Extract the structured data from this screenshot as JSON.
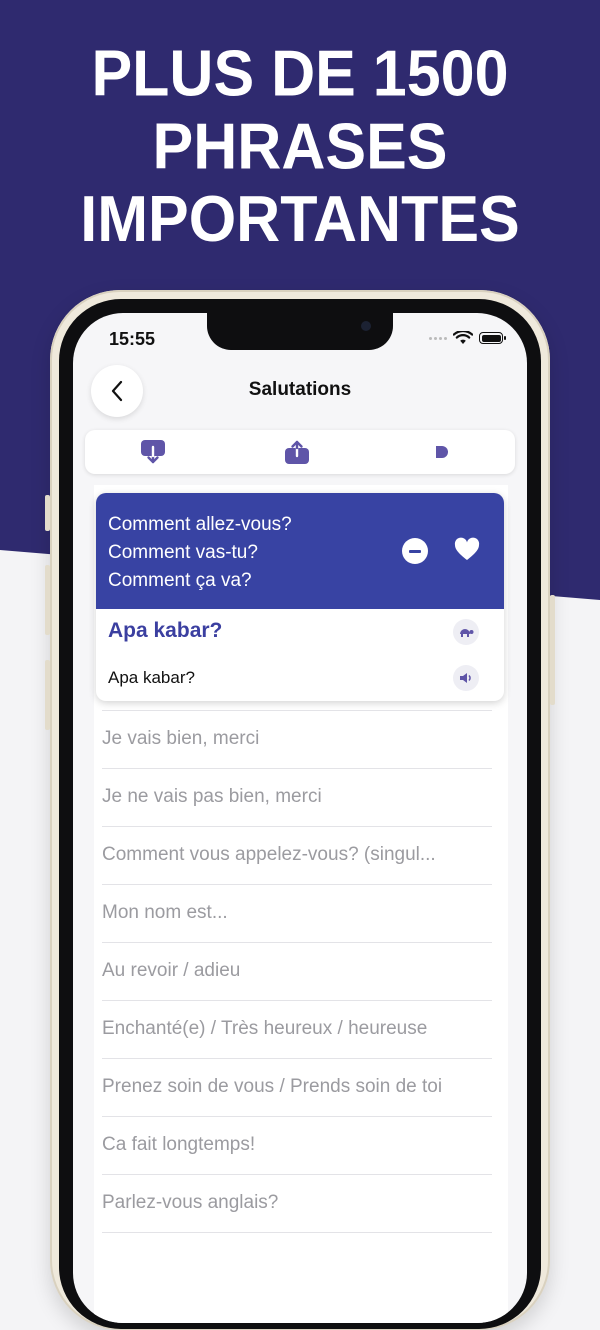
{
  "banner": {
    "lines": [
      "PLUS DE 1500",
      "PHRASES",
      "IMPORTANTES"
    ]
  },
  "status_bar": {
    "time": "15:55"
  },
  "header": {
    "title": "Salutations",
    "back_icon": "chevron-left-icon"
  },
  "toolbar": {
    "items": [
      {
        "icon": "download-icon"
      },
      {
        "icon": "share-icon"
      },
      {
        "icon": "play-icon"
      }
    ]
  },
  "selected_card": {
    "french_lines": [
      "Comment allez-vous?",
      "Comment vas-tu?",
      "Comment ça va?"
    ],
    "translation": "Apa kabar?",
    "phonetic": "Apa kabar?",
    "icons": [
      "minus-circle-icon",
      "heart-icon",
      "turtle-slow-icon",
      "speaker-icon"
    ]
  },
  "phrases": [
    "Je vais bien, merci",
    "Je ne vais pas bien, merci",
    "Comment vous appelez-vous? (singul...",
    "Mon nom est...",
    "Au revoir / adieu",
    "Enchanté(e) / Très heureux / heureuse",
    "Prenez soin de vous / Prends soin de toi",
    "Ca fait longtemps!",
    "Parlez-vous anglais?"
  ],
  "colors": {
    "banner_bg": "#2f2a6f",
    "accent": "#3843a3",
    "translation_text": "#3b3fa0",
    "icon_purple": "#5f55a8"
  }
}
